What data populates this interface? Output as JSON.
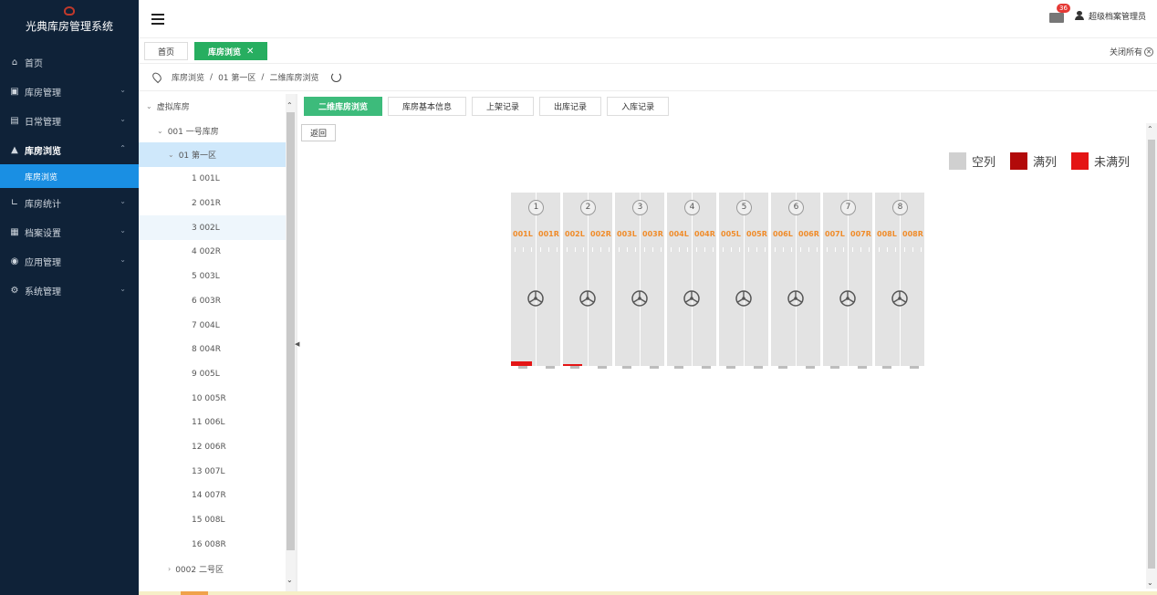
{
  "app": {
    "title": "光典库房管理系统"
  },
  "sidebar": {
    "items": [
      {
        "label": "首页",
        "icon": "home-icon"
      },
      {
        "label": "库房管理",
        "icon": "building-icon"
      },
      {
        "label": "日常管理",
        "icon": "document-icon"
      },
      {
        "label": "库房浏览",
        "icon": "warehouse-icon",
        "open": true
      },
      {
        "label": "库房统计",
        "icon": "chart-icon"
      },
      {
        "label": "档案设置",
        "icon": "archive-icon"
      },
      {
        "label": "应用管理",
        "icon": "apps-icon"
      },
      {
        "label": "系统管理",
        "icon": "gear-icon"
      }
    ],
    "active_sub": "库房浏览"
  },
  "header": {
    "message_count": "36",
    "user": "超级档案管理员"
  },
  "tabs": {
    "home": "首页",
    "active": "库房浏览",
    "close_all": "关闭所有"
  },
  "breadcrumb": {
    "a": "库房浏览",
    "b": "01 第一区",
    "c": "二维库房浏览",
    "sep": "/"
  },
  "tree": {
    "root": "虚拟库房",
    "warehouse": "001 一号库房",
    "zone": "01 第一区",
    "leaves": [
      "1 001L",
      "2 001R",
      "3 002L",
      "4 002R",
      "5 003L",
      "6 003R",
      "7 004L",
      "8 004R",
      "9 005L",
      "10 005R",
      "11 006L",
      "12 006R",
      "13 007L",
      "14 007R",
      "15 008L",
      "16 008R"
    ],
    "next_zone": "0002 二号区"
  },
  "subtabs": [
    "二维库房浏览",
    "库房基本信息",
    "上架记录",
    "出库记录",
    "入库记录"
  ],
  "back_label": "返回",
  "legend": [
    {
      "label": "空列",
      "color": "#d0d0d0"
    },
    {
      "label": "满列",
      "color": "#b20a0a"
    },
    {
      "label": "未满列",
      "color": "#e41515"
    }
  ],
  "columns": [
    {
      "n": "1",
      "l": "001L",
      "r": "001R",
      "fill_l": 0.9,
      "fill_r": 0
    },
    {
      "n": "2",
      "l": "002L",
      "r": "002R",
      "fill_l": 0.85,
      "fill_r": 0
    },
    {
      "n": "3",
      "l": "003L",
      "r": "003R",
      "fill_l": 0,
      "fill_r": 0
    },
    {
      "n": "4",
      "l": "004L",
      "r": "004R",
      "fill_l": 0,
      "fill_r": 0
    },
    {
      "n": "5",
      "l": "005L",
      "r": "005R",
      "fill_l": 0,
      "fill_r": 0
    },
    {
      "n": "6",
      "l": "006L",
      "r": "006R",
      "fill_l": 0,
      "fill_r": 0
    },
    {
      "n": "7",
      "l": "007L",
      "r": "007R",
      "fill_l": 0,
      "fill_r": 0
    },
    {
      "n": "8",
      "l": "008L",
      "r": "008R",
      "fill_l": 0,
      "fill_r": 0
    }
  ]
}
